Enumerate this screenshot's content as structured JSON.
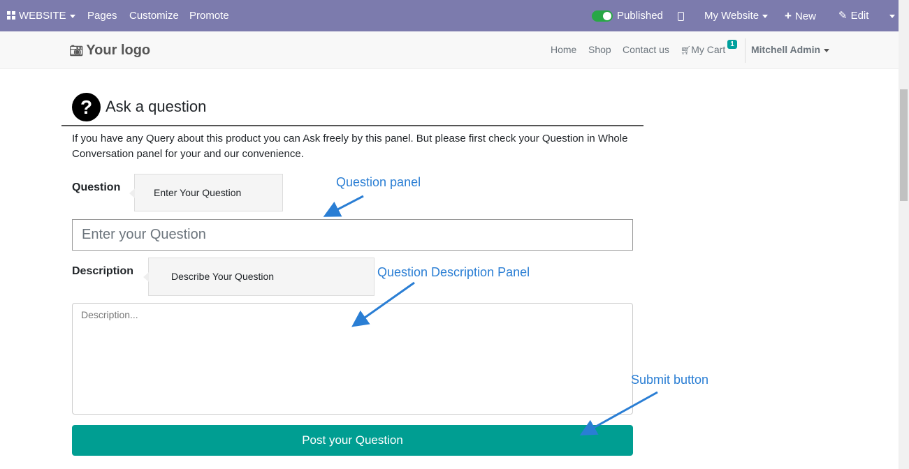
{
  "topbar": {
    "website": "WEBSITE",
    "pages": "Pages",
    "customize": "Customize",
    "promote": "Promote",
    "published": "Published",
    "my_website": "My Website",
    "new": "New",
    "edit": "Edit"
  },
  "navbar": {
    "logo": "Your logo",
    "home": "Home",
    "shop": "Shop",
    "contact": "Contact us",
    "cart": "My Cart",
    "cart_count": "1",
    "user": "Mitchell Admin"
  },
  "form": {
    "title": "Ask a question",
    "title_icon": "?",
    "intro": "If you have any Query about this product you can Ask freely by this panel. But please first check your Question in Whole Conversation panel for your and our convenience.",
    "question_label": "Question",
    "question_tooltip": "Enter Your Question",
    "question_placeholder": "Enter your Question",
    "description_label": "Description",
    "description_tooltip": "Describe Your Question",
    "description_placeholder": "Description...",
    "submit_label": "Post your Question"
  },
  "annotations": {
    "question_panel": "Question panel",
    "description_panel": "Question Description Panel",
    "submit_button": "Submit button"
  },
  "colors": {
    "topbar": "#7c7bad",
    "submit": "#009e92",
    "annotation": "#2a7ed4"
  }
}
